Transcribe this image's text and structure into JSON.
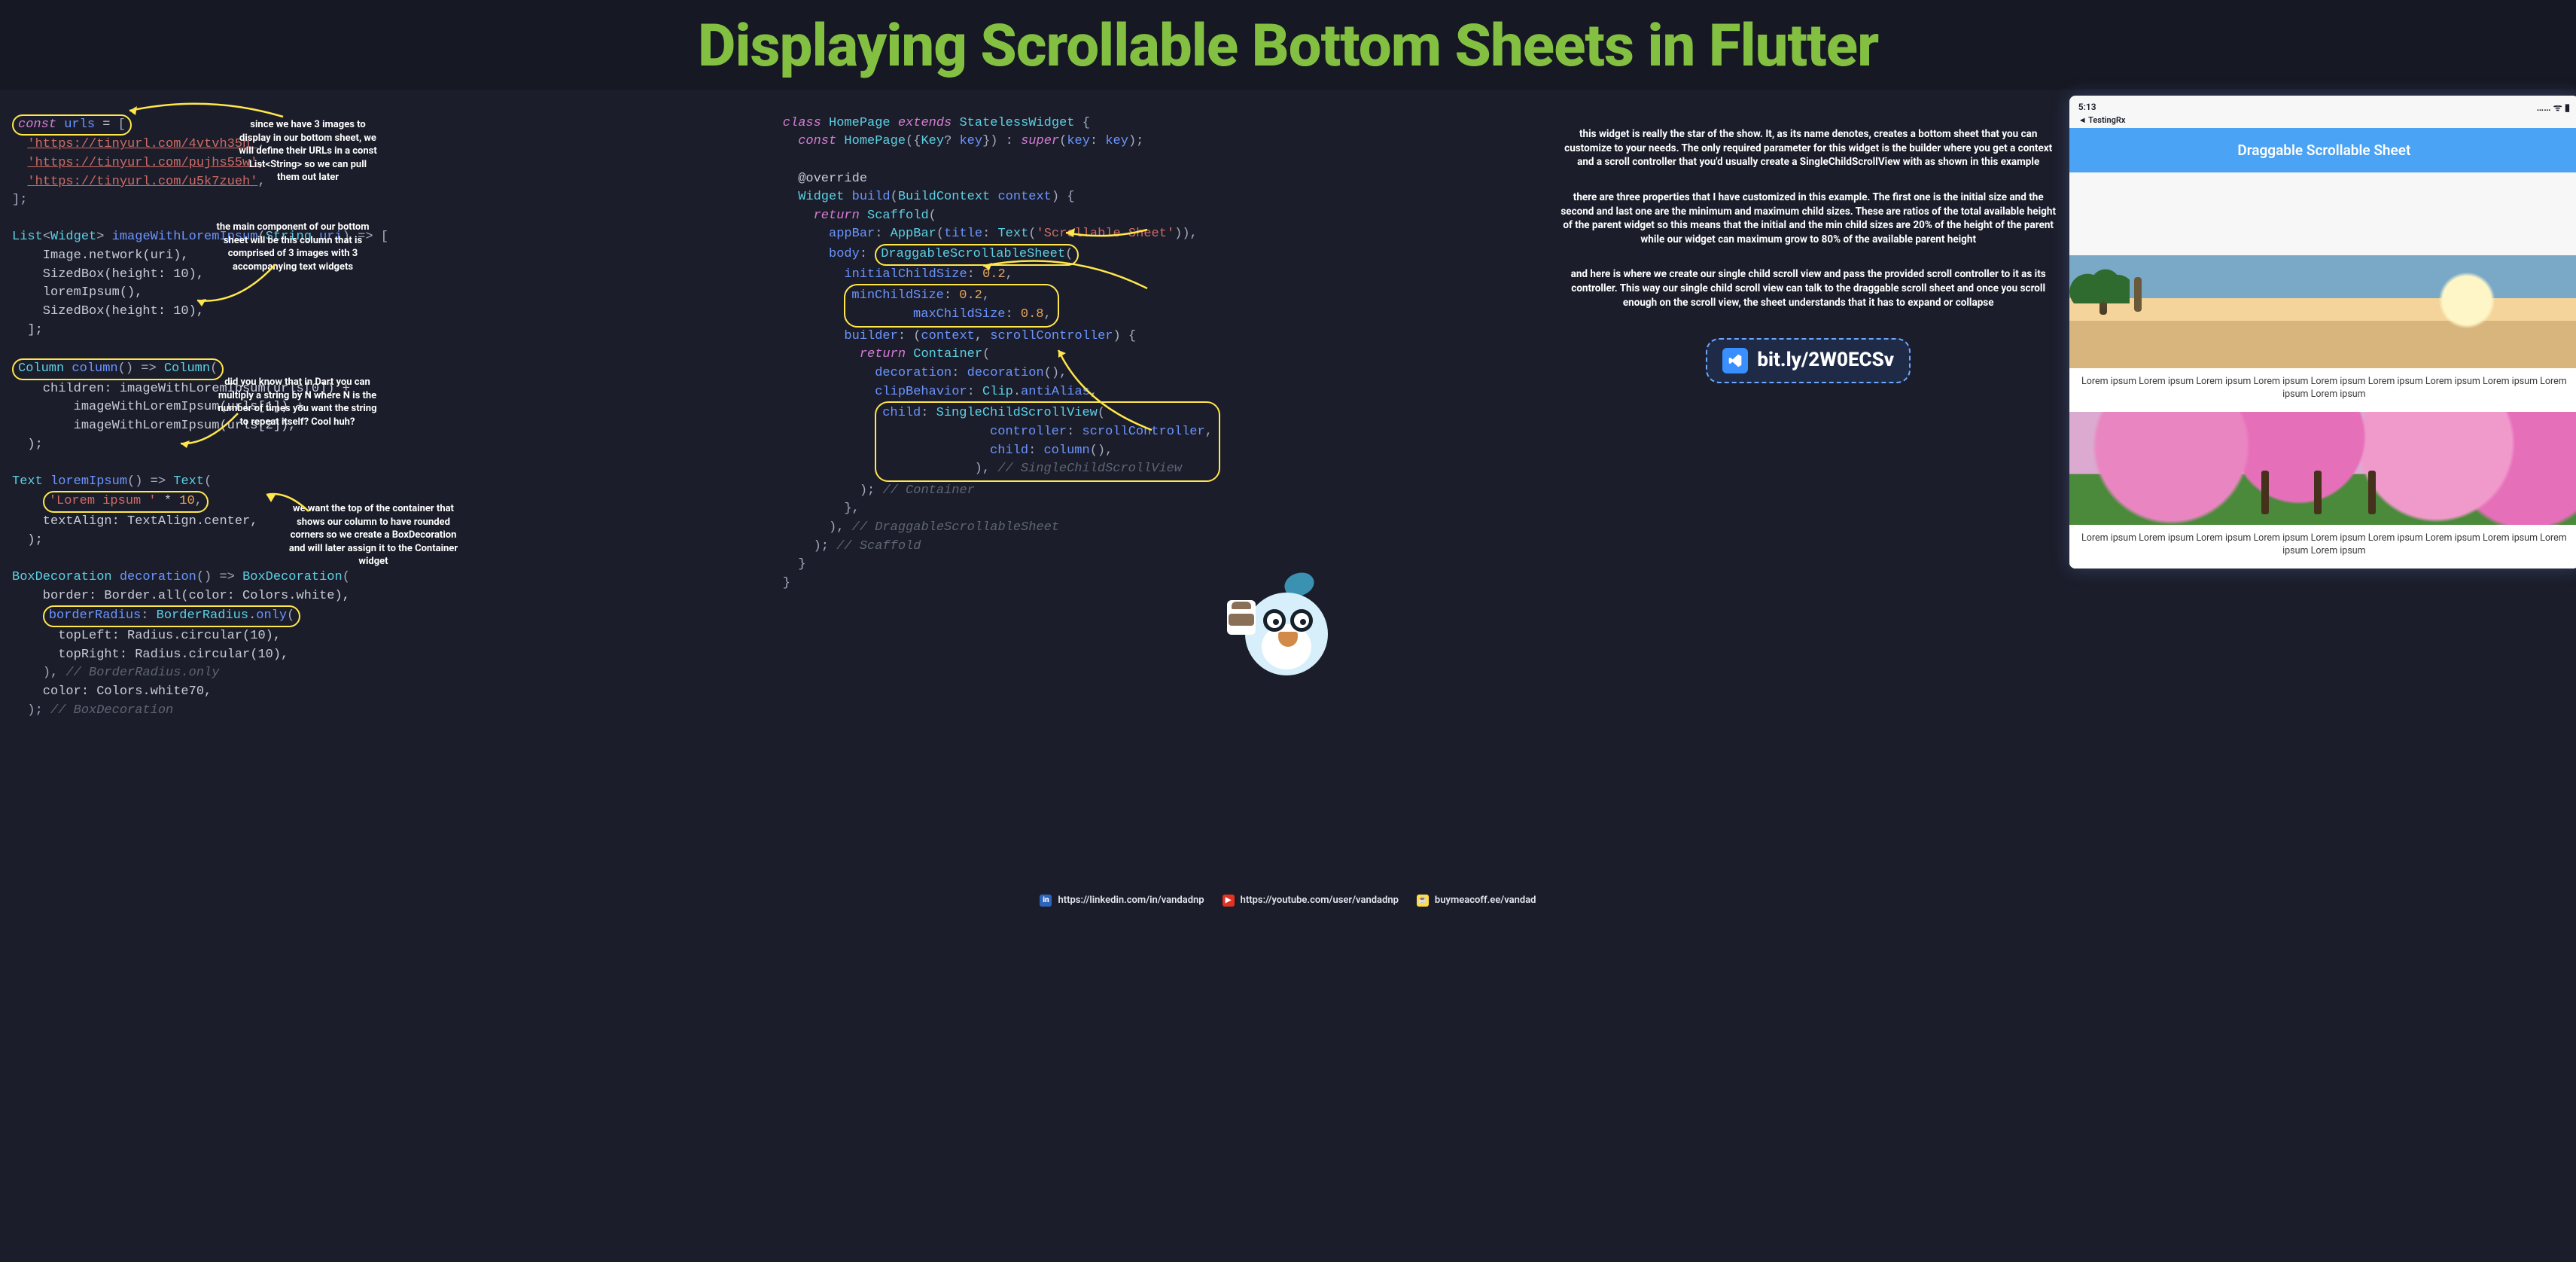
{
  "title": "Displaying Scrollable Bottom Sheets in Flutter",
  "code_left": {
    "const_urls_header": "const urls = [",
    "url1": "'https://tinyurl.com/4vtvh35h'",
    "url2": "'https://tinyurl.com/pujhs55w'",
    "url3": "'https://tinyurl.com/u5k7zueh'",
    "list_close": "];",
    "fn_imageWithLoremIpsum_sig": "List<Widget> imageWithLoremIpsum(String uri) => [",
    "image_network": "    Image.network(uri),",
    "sizedbox1": "    SizedBox(height: 10),",
    "loremipsum_call": "    loremIpsum(),",
    "sizedbox2": "    SizedBox(height: 10),",
    "close_list2": "  ];",
    "column_sig": "Column column() => Column(",
    "column_children1": "    children: imageWithLoremIpsum(urls[0]) +",
    "column_children2": "        imageWithLoremIpsum(urls[1]) +",
    "column_children3": "        imageWithLoremIpsum(urls[2]),",
    "column_close": "  );",
    "lorem_sig": "Text loremIpsum() => Text(",
    "lorem_str": "    'Lorem ipsum ' * 10,",
    "lorem_align": "    textAlign: TextAlign.center,",
    "lorem_close": "  );",
    "decoration_sig": "BoxDecoration decoration() => BoxDecoration(",
    "decoration_border": "    border: Border.all(color: Colors.white),",
    "decoration_radius_hdr": "    borderRadius: BorderRadius.only(",
    "decoration_tl": "      topLeft: Radius.circular(10),",
    "decoration_tr": "      topRight: Radius.circular(10),",
    "decoration_radius_close": "    ), // BorderRadius.only",
    "decoration_color": "    color: Colors.white70,",
    "decoration_close": "  ); // BoxDecoration"
  },
  "code_right": {
    "l1": "class HomePage extends StatelessWidget {",
    "l2": "  const HomePage({Key? key}) : super(key: key);",
    "l3": "",
    "l4": "  @override",
    "l5": "  Widget build(BuildContext context) {",
    "l6": "    return Scaffold(",
    "l7": "      appBar: AppBar(title: Text('Scrollable Sheet')),",
    "l8_pre": "      body: ",
    "l8_box": "DraggableScrollableSheet(",
    "l9": "        initialChildSize: 0.2,",
    "l10a": "        minChildSize: 0.2,",
    "l10b": "        maxChildSize: 0.8,",
    "l11": "        builder: (context, scrollController) {",
    "l12": "          return Container(",
    "l13": "            decoration: decoration(),",
    "l14": "            clipBehavior: Clip.antiAlias,",
    "l15a": "            child: SingleChildScrollView(",
    "l15b": "              controller: scrollController,",
    "l15c": "              child: column(),",
    "l15d": "            ), // SingleChildScrollView",
    "l16": "          ); // Container",
    "l17": "        },",
    "l18": "      ), // DraggableScrollableSheet",
    "l19": "    ); // Scaffold",
    "l20": "  }",
    "l21": "}"
  },
  "annotations": {
    "a1": "since we have 3 images to display in our bottom sheet, we will define their URLs in a const List<String> so we can pull them out later",
    "a2": "the main component of our bottom sheet will be this column that is comprised of 3 images with 3 accompanying text widgets",
    "a3": "did you know that in Dart you can multiply a string by N where N is the number of times you want the string to repeat itself? Cool huh?",
    "a4": "we want the top of the container that shows our column to have rounded corners so we create a BoxDecoration and will later assign it to the Container widget",
    "r1": "this widget is really the star of the show. It, as its name denotes, creates a bottom sheet that you can customize to your needs. The only required parameter for this widget is the builder where you get a context and a scroll controller that you'd usually create a SingleChildScrollView with as shown in this example",
    "r2": "there are three properties that I have customized in this example. The first one is the initial size and the second and last one are the minimum and maximum child sizes. These are ratios of the total available height of the parent widget so this means that the initial and the min child sizes are 20% of the height of the parent while our widget can maximum grow to 80% of the available parent height",
    "r3": "and here is where we create our single child scroll view and pass the provided scroll controller to it as its controller. This way our single child scroll view can talk to the draggable scroll sheet and once you scroll enough on the scroll view, the sheet understands that it has to expand or collapse"
  },
  "link_badge": "bit.ly/2W0ECSv",
  "phone": {
    "time": "5:13",
    "testing": "◄ TestingRx",
    "wifi": "…… ᯤ ▮",
    "appbar_title": "Draggable Scrollable Sheet",
    "caption": "Lorem ipsum Lorem ipsum Lorem ipsum Lorem ipsum Lorem ipsum Lorem ipsum Lorem ipsum Lorem ipsum Lorem ipsum Lorem ipsum"
  },
  "footer": {
    "linkedin": "https://linkedin.com/in/vandadnp",
    "youtube": "https://youtube.com/user/vandadnp",
    "bmc": "buymeacoff.ee/vandad"
  }
}
